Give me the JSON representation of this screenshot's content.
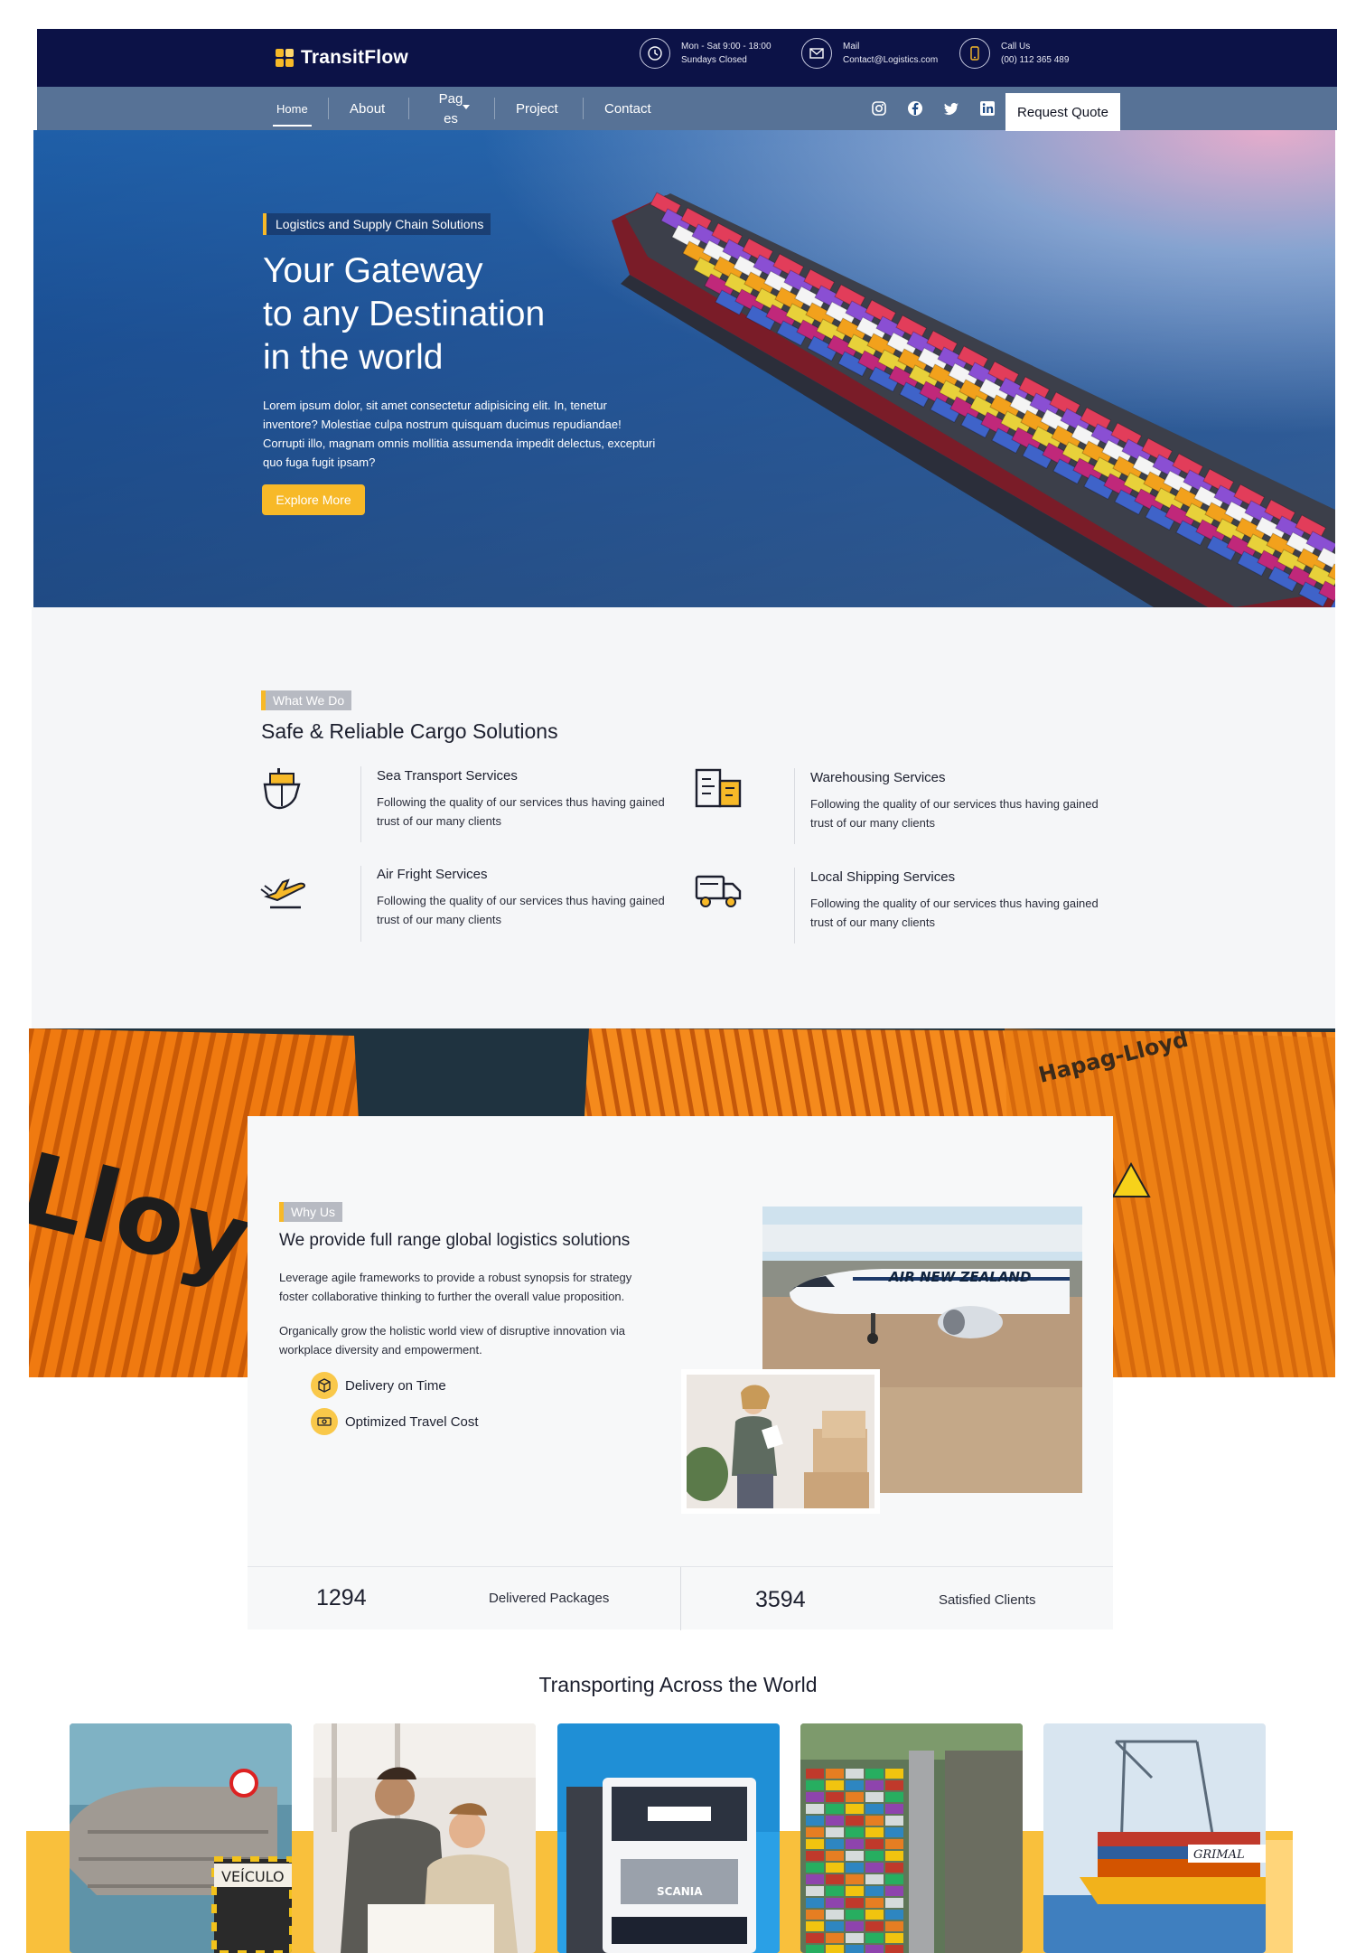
{
  "brand": {
    "name": "TransitFlow",
    "accent": "#f7b928",
    "navy": "#0c1247"
  },
  "header": {
    "hours": {
      "icon": "clock-icon",
      "line1": "Mon - Sat 9:00 - 18:00",
      "line2": "Sundays Closed"
    },
    "mail": {
      "icon": "mail-icon",
      "line1": "Mail",
      "line2": "Contact@Logistics.com"
    },
    "call": {
      "icon": "phone-icon",
      "line1": "Call Us",
      "line2": "(00) 112 365 489"
    }
  },
  "nav": {
    "items": [
      {
        "label": "Home",
        "active": true
      },
      {
        "label": "About"
      },
      {
        "label": "Pag es"
      },
      {
        "label": "Project"
      },
      {
        "label": "Contact"
      }
    ],
    "social": [
      "instagram-icon",
      "facebook-icon",
      "twitter-icon",
      "linkedin-icon"
    ],
    "quote_label": "Request Quote"
  },
  "hero": {
    "tag": "Logistics and Supply Chain Solutions",
    "title_line1": "Your Gateway",
    "title_line2": "to any Destination",
    "title_line3": "in the world",
    "text": "Lorem ipsum dolor, sit amet consectetur adipisicing elit. In, tenetur inventore? Molestiae culpa nostrum quisquam ducimus repudiandae! Corrupti illo, magnam omnis mollitia assumenda impedit delectus, excepturi quo fuga fugit ipsam?",
    "button": "Explore More"
  },
  "services": {
    "tag": "What We Do",
    "title": "Safe & Reliable Cargo Solutions",
    "items": [
      {
        "icon": "ship-icon",
        "title": "Sea Transport Services",
        "desc": "Following the quality of our services thus having gained trust of our many clients"
      },
      {
        "icon": "warehouse-icon",
        "title": "Warehousing Services",
        "desc": "Following the quality of our services thus having gained trust of our many clients"
      },
      {
        "icon": "airplane-icon",
        "title": "Air Fright Services",
        "desc": "Following the quality of our services thus having gained trust of our many clients"
      },
      {
        "icon": "truck-icon",
        "title": "Local Shipping Services",
        "desc": "Following the quality of our services thus having gained trust of our many clients"
      }
    ]
  },
  "why": {
    "tag": "Why Us",
    "title": "We provide full range global logistics solutions",
    "p1": "Leverage agile frameworks to provide a robust synopsis for strategy foster collaborative thinking to further the overall value proposition.",
    "p2": "Organically grow the holistic world view of disruptive innovation via workplace diversity and empowerment.",
    "features": [
      {
        "icon": "box-icon",
        "label": "Delivery on Time"
      },
      {
        "icon": "money-icon",
        "label": "Optimized Travel Cost"
      }
    ],
    "plane_text": "AIR NEW ZEALAND"
  },
  "stats": [
    {
      "value": "1294",
      "label": "Delivered Packages"
    },
    {
      "value": "3594",
      "label": "Satisfied Clients"
    }
  ],
  "band": {
    "container_text": "Lloyd",
    "container_text2": "Hapag-Lloyd"
  },
  "world": {
    "title": "Transporting Across the World",
    "cards": [
      {
        "name": "tanker-truck",
        "caption": "VEÍCULO"
      },
      {
        "name": "team-working"
      },
      {
        "name": "semi-truck",
        "caption": "SCANIA"
      },
      {
        "name": "container-port"
      },
      {
        "name": "cargo-ship",
        "caption": "GRIMAL"
      }
    ]
  }
}
